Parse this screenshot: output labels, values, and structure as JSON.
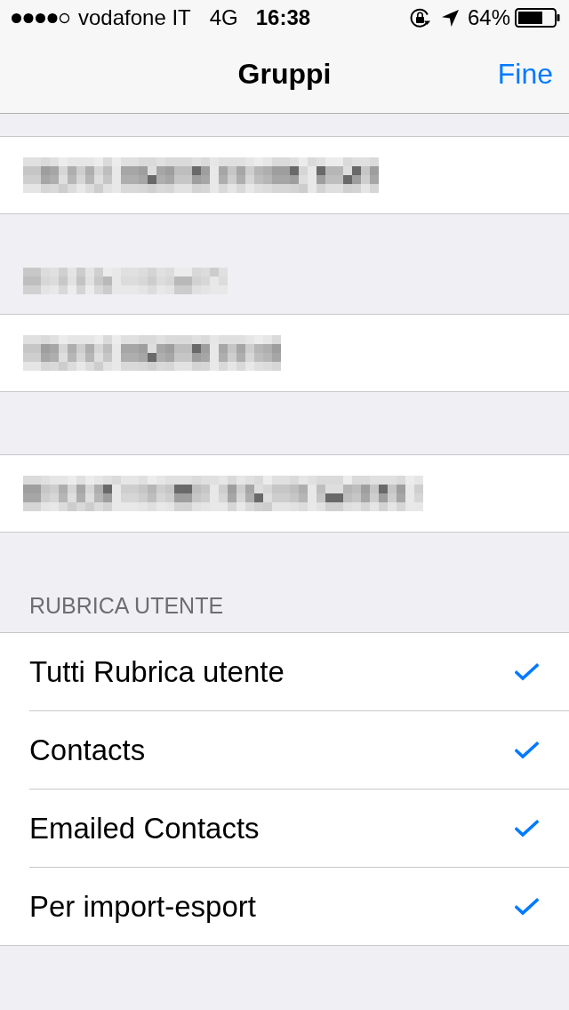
{
  "status_bar": {
    "carrier": "vodafone IT",
    "network": "4G",
    "time": "16:38",
    "battery": "64%"
  },
  "nav_bar": {
    "title": "Gruppi",
    "done_button": "Fine"
  },
  "sections": [
    {
      "rows": [
        {
          "kind": "redacted"
        }
      ]
    },
    {
      "header": {
        "kind": "redacted"
      },
      "rows": [
        {
          "kind": "redacted"
        }
      ]
    },
    {
      "rows": [
        {
          "kind": "redacted"
        }
      ]
    },
    {
      "header": {
        "kind": "text",
        "text": "RUBRICA UTENTE"
      },
      "rows": [
        {
          "kind": "group",
          "label": "Tutti Rubrica utente",
          "checked": true
        },
        {
          "kind": "group",
          "label": "Contacts",
          "checked": true
        },
        {
          "kind": "group",
          "label": "Emailed Contacts",
          "checked": true
        },
        {
          "kind": "group",
          "label": "Per import-esport",
          "checked": true
        }
      ]
    }
  ]
}
